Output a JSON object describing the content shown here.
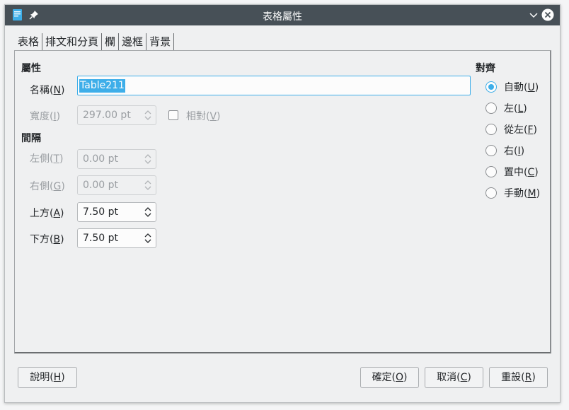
{
  "window": {
    "title": "表格屬性"
  },
  "tabs": [
    {
      "label": "表格"
    },
    {
      "label": "排文和分頁"
    },
    {
      "label": "欄"
    },
    {
      "label": "邊框"
    },
    {
      "label": "背景"
    }
  ],
  "properties": {
    "heading": "屬性",
    "name": {
      "label": "名稱(",
      "mnemonic": "N",
      "value": "Table211"
    },
    "width": {
      "label": "寬度(",
      "mnemonic": "I",
      "value": "297.00 pt"
    },
    "relative": {
      "label": "相對(",
      "mnemonic": "V",
      "checked": false
    }
  },
  "spacing": {
    "heading": "間隔",
    "left": {
      "label": "左側(",
      "mnemonic": "T",
      "value": "0.00 pt"
    },
    "right": {
      "label": "右側(",
      "mnemonic": "G",
      "value": "0.00 pt"
    },
    "above": {
      "label": "上方(",
      "mnemonic": "A",
      "value": "7.50 pt"
    },
    "below": {
      "label": "下方(",
      "mnemonic": "B",
      "value": "7.50 pt"
    }
  },
  "alignment": {
    "heading": "對齊",
    "options": [
      {
        "label": "自動(",
        "mnemonic": "U",
        "checked": true
      },
      {
        "label": "左(",
        "mnemonic": "L",
        "checked": false
      },
      {
        "label": "從左(",
        "mnemonic": "F",
        "checked": false
      },
      {
        "label": "右(",
        "mnemonic": "I",
        "checked": false
      },
      {
        "label": "置中(",
        "mnemonic": "C",
        "checked": false
      },
      {
        "label": "手動(",
        "mnemonic": "M",
        "checked": false
      }
    ]
  },
  "buttons": {
    "help": {
      "label": "說明(",
      "mnemonic": "H"
    },
    "ok": {
      "label": "確定(",
      "mnemonic": "O"
    },
    "cancel": {
      "label": "取消(",
      "mnemonic": "C"
    },
    "reset": {
      "label": "重設(",
      "mnemonic": "R"
    }
  },
  "paren_close": ")",
  "colors": {
    "accent": "#3daee9",
    "titlebar": "#475057",
    "background": "#eff0f1"
  },
  "icons": [
    "writer-document-icon",
    "pin-icon",
    "chevron-down-icon",
    "close-icon",
    "spin-arrows-icon"
  ]
}
